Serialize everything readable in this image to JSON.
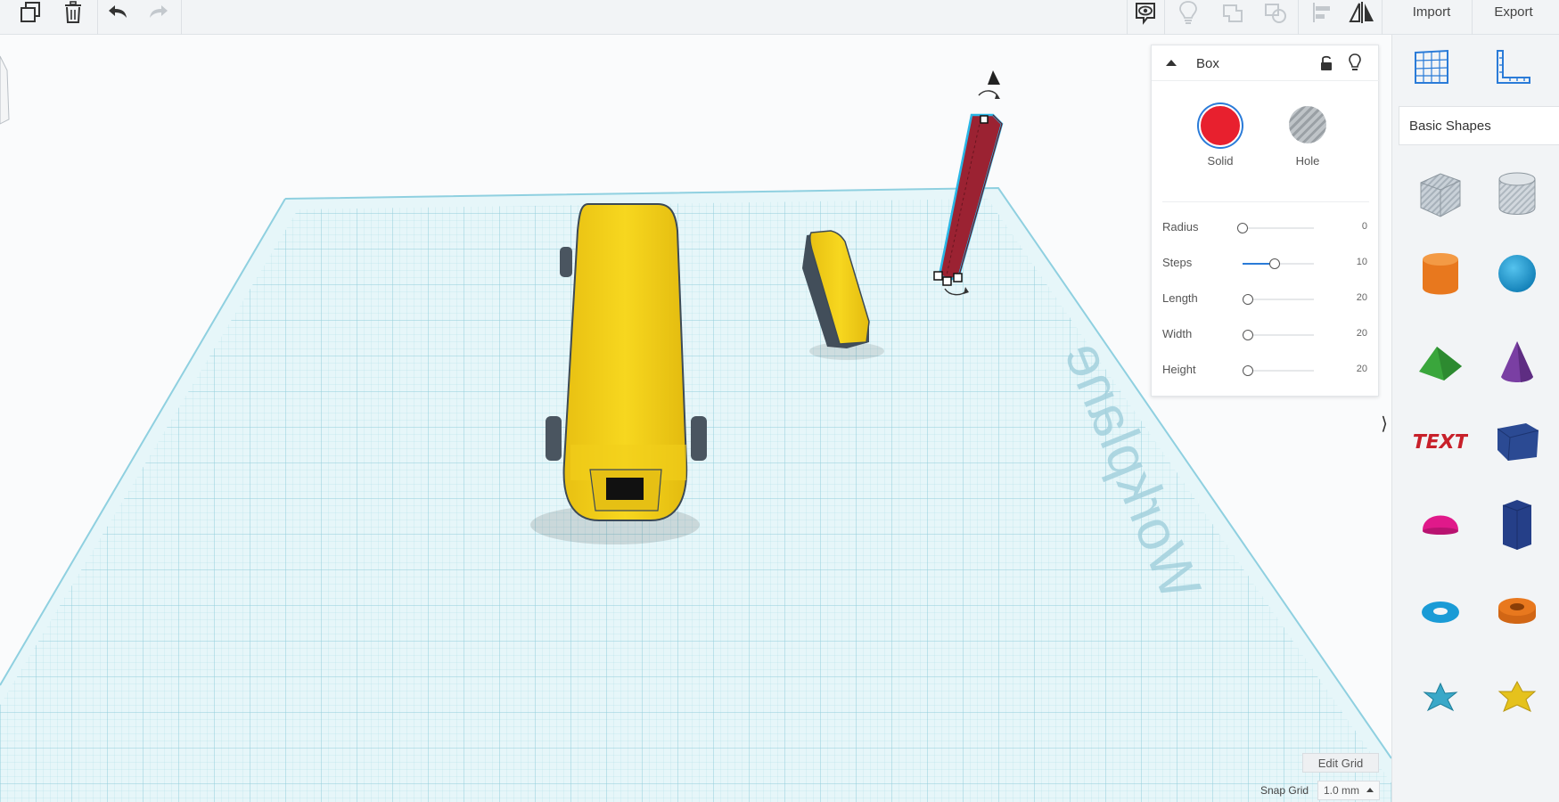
{
  "toolbar": {
    "left_tools": [
      "copy-icon",
      "trash-icon",
      "undo-icon",
      "redo-icon"
    ],
    "right_tools": [
      "eye-speech-icon",
      "lightbulb-icon",
      "group-icon",
      "ungroup-icon",
      "align-icon",
      "mirror-icon"
    ],
    "import_label": "Import",
    "export_label": "Export"
  },
  "workplane": {
    "watermark": "Workplane"
  },
  "inspector": {
    "title": "Box",
    "solid_label": "Solid",
    "hole_label": "Hole",
    "solid_color": "#e8202e",
    "properties": [
      {
        "name": "Radius",
        "value": "0",
        "fill": 0.0
      },
      {
        "name": "Steps",
        "value": "10",
        "fill": 0.45
      },
      {
        "name": "Length",
        "value": "20",
        "fill": 0.08
      },
      {
        "name": "Width",
        "value": "20",
        "fill": 0.08
      },
      {
        "name": "Height",
        "value": "20",
        "fill": 0.08
      }
    ]
  },
  "sidebar": {
    "view_buttons": [
      "workplane-grid-icon",
      "ruler-icon"
    ],
    "category": "Basic Shapes",
    "shapes": [
      {
        "name": "box-striped",
        "color": "#b9c3cc"
      },
      {
        "name": "cylinder-striped",
        "color": "#c4ccd3"
      },
      {
        "name": "cylinder",
        "color": "#e8781e"
      },
      {
        "name": "sphere",
        "color": "#1a9bd6"
      },
      {
        "name": "roof",
        "color": "#3aa63c"
      },
      {
        "name": "cone",
        "color": "#7a3fa3"
      },
      {
        "name": "text",
        "color": "#c8202a"
      },
      {
        "name": "wedge",
        "color": "#2b4a93"
      },
      {
        "name": "half-sphere",
        "color": "#e0198a"
      },
      {
        "name": "polygon",
        "color": "#253f88"
      },
      {
        "name": "torus",
        "color": "#1a9bd6"
      },
      {
        "name": "tube",
        "color": "#e8781e"
      },
      {
        "name": "star",
        "color": "#3aa8c8"
      },
      {
        "name": "star-gold",
        "color": "#e5c21c"
      }
    ]
  },
  "grid": {
    "edit_label": "Edit Grid",
    "snap_label": "Snap Grid",
    "snap_value": "1.0 mm"
  }
}
